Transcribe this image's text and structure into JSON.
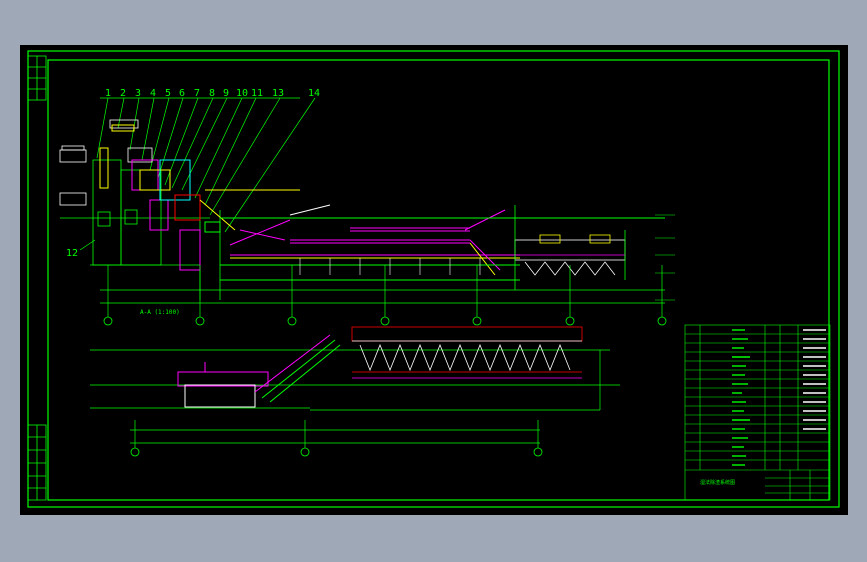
{
  "colors": {
    "background": "#9ea8b7",
    "canvas": "#000000",
    "frame": "#00ff00",
    "yellow": "#ffff00",
    "magenta": "#ff00ff",
    "white": "#ffffff",
    "red": "#ff0000",
    "cyan": "#00ffff"
  },
  "callout_numbers": [
    "1",
    "2",
    "3",
    "4",
    "5",
    "6",
    "7",
    "8",
    "9",
    "10",
    "11",
    "13",
    "14",
    "12"
  ],
  "section_label": "A-A (1:100)",
  "title_block": {
    "drawing_title": "湿法除渣系统图"
  },
  "bubbles_upper": [
    "①",
    "②",
    "③",
    "④",
    "⑤",
    "⑥"
  ],
  "bubbles_lower": [
    "①",
    "②",
    "③"
  ]
}
